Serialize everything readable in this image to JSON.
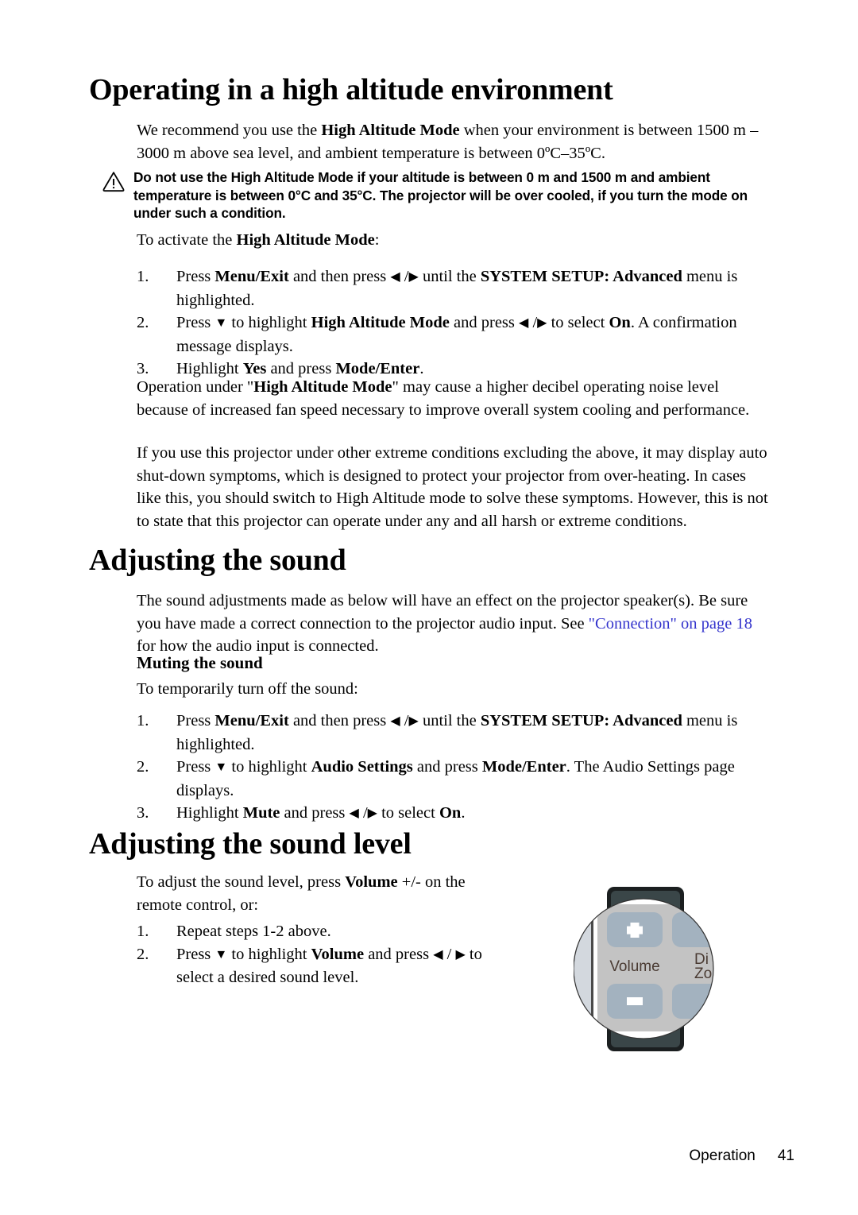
{
  "page": {
    "footer_section": "Operation",
    "footer_page_number": "41"
  },
  "colors": {
    "link": "#3333CC",
    "remote_body": "#3A4648",
    "remote_bezel": "#1B1F20",
    "remote_keypad": "#C3C3C3",
    "remote_button": "#A3B2BF",
    "remote_label": "#4A3B33"
  },
  "sections": {
    "high_altitude": {
      "heading": "Operating in a high altitude environment",
      "intro_pre": "We recommend you use the ",
      "intro_bold": "High Altitude Mode",
      "intro_post": " when your environment is between 1500 m –3000 m above sea level, and ambient temperature is between 0ºC–35ºC.",
      "warning_icon": "warning-triangle-icon",
      "warning": "Do not use the High Altitude Mode if your altitude is between 0 m and 1500 m and ambient temperature is between 0°C and 35°C. The projector will be over cooled, if you turn the mode on under such a condition.",
      "activate_pre": "To activate the ",
      "activate_bold": "High Altitude Mode",
      "activate_post": ":",
      "steps": [
        {
          "num": "1.",
          "parts": [
            {
              "t": "Press ",
              "s": "n"
            },
            {
              "t": "Menu/Exit",
              "s": "b"
            },
            {
              "t": " and then press ",
              "s": "n"
            },
            {
              "t": "◀",
              "s": "a"
            },
            {
              "t": " /",
              "s": "n"
            },
            {
              "t": "▶",
              "s": "a"
            },
            {
              "t": " until the ",
              "s": "n"
            },
            {
              "t": "SYSTEM SETUP: Advanced",
              "s": "b"
            },
            {
              "t": " menu is highlighted.",
              "s": "n"
            }
          ]
        },
        {
          "num": "2.",
          "parts": [
            {
              "t": "Press ",
              "s": "n"
            },
            {
              "t": "▼",
              "s": "a"
            },
            {
              "t": " to highlight ",
              "s": "n"
            },
            {
              "t": "High Altitude Mode",
              "s": "b"
            },
            {
              "t": " and press ",
              "s": "n"
            },
            {
              "t": "◀",
              "s": "a"
            },
            {
              "t": " /",
              "s": "n"
            },
            {
              "t": "▶",
              "s": "a"
            },
            {
              "t": " to select ",
              "s": "n"
            },
            {
              "t": "On",
              "s": "b"
            },
            {
              "t": ". A confirmation message displays.",
              "s": "n"
            }
          ]
        },
        {
          "num": "3.",
          "parts": [
            {
              "t": "Highlight ",
              "s": "n"
            },
            {
              "t": "Yes",
              "s": "b"
            },
            {
              "t": " and press ",
              "s": "n"
            },
            {
              "t": "Mode/Enter",
              "s": "b"
            },
            {
              "t": ".",
              "s": "n"
            }
          ]
        }
      ],
      "note_pre": "Operation under \"",
      "note_bold": "High Altitude Mode",
      "note_post": "\" may cause a higher decibel operating noise level because of increased fan speed necessary to improve overall system cooling and performance.",
      "extreme": "If you use this projector under other extreme conditions excluding the above, it may display auto shut-down symptoms, which is designed to protect your projector from over-heating. In cases like this, you should switch to High Altitude mode to solve these symptoms. However, this is not to state that this projector can operate under any and all harsh or extreme conditions."
    },
    "adjusting_sound": {
      "heading": "Adjusting the sound",
      "intro_pre": "The sound adjustments made as below will have an effect on the projector speaker(s). Be sure you have made a correct connection to the projector audio input. See ",
      "intro_link": "\"Connection\" on page 18",
      "intro_post": " for how the audio input is connected.",
      "subheading": "Muting the sound",
      "lead": "To temporarily turn off the sound:",
      "steps": [
        {
          "num": "1.",
          "parts": [
            {
              "t": "Press ",
              "s": "n"
            },
            {
              "t": "Menu/Exit",
              "s": "b"
            },
            {
              "t": " and then press ",
              "s": "n"
            },
            {
              "t": "◀",
              "s": "a"
            },
            {
              "t": " /",
              "s": "n"
            },
            {
              "t": "▶",
              "s": "a"
            },
            {
              "t": " until the ",
              "s": "n"
            },
            {
              "t": "SYSTEM SETUP: Advanced",
              "s": "b"
            },
            {
              "t": " menu is highlighted.",
              "s": "n"
            }
          ]
        },
        {
          "num": "2.",
          "parts": [
            {
              "t": "Press ",
              "s": "n"
            },
            {
              "t": "▼",
              "s": "a"
            },
            {
              "t": " to highlight ",
              "s": "n"
            },
            {
              "t": "Audio Settings",
              "s": "b"
            },
            {
              "t": " and press ",
              "s": "n"
            },
            {
              "t": "Mode/Enter",
              "s": "b"
            },
            {
              "t": ". The Audio Settings page displays.",
              "s": "n"
            }
          ]
        },
        {
          "num": "3.",
          "parts": [
            {
              "t": "Highlight ",
              "s": "n"
            },
            {
              "t": "Mute",
              "s": "b"
            },
            {
              "t": " and press ",
              "s": "n"
            },
            {
              "t": "◀",
              "s": "a"
            },
            {
              "t": " /",
              "s": "n"
            },
            {
              "t": "▶",
              "s": "a"
            },
            {
              "t": " to select ",
              "s": "n"
            },
            {
              "t": "On",
              "s": "b"
            },
            {
              "t": ".",
              "s": "n"
            }
          ]
        }
      ]
    },
    "sound_level": {
      "heading": "Adjusting the sound level",
      "lead_pre": "To adjust the sound level, press ",
      "lead_bold": "Volume",
      "lead_post": " +/- on the remote control, or:",
      "steps": [
        {
          "num": "1.",
          "parts": [
            {
              "t": "Repeat steps 1-2 above.",
              "s": "n"
            }
          ]
        },
        {
          "num": "2.",
          "parts": [
            {
              "t": "Press ",
              "s": "n"
            },
            {
              "t": "▼",
              "s": "a"
            },
            {
              "t": " to highlight ",
              "s": "n"
            },
            {
              "t": "Volume",
              "s": "b"
            },
            {
              "t": " and press ",
              "s": "n"
            },
            {
              "t": "◀",
              "s": "a"
            },
            {
              "t": " / ",
              "s": "n"
            },
            {
              "t": "▶",
              "s": "a"
            },
            {
              "t": " to select a desired sound level.",
              "s": "n"
            }
          ]
        }
      ],
      "remote_figure": {
        "name": "remote-control-volume-illustration",
        "plus_label": "+",
        "minus_label": "−",
        "volume_label": "Volume",
        "side_label_line1": "Di",
        "side_label_line2": "Zo"
      }
    }
  }
}
